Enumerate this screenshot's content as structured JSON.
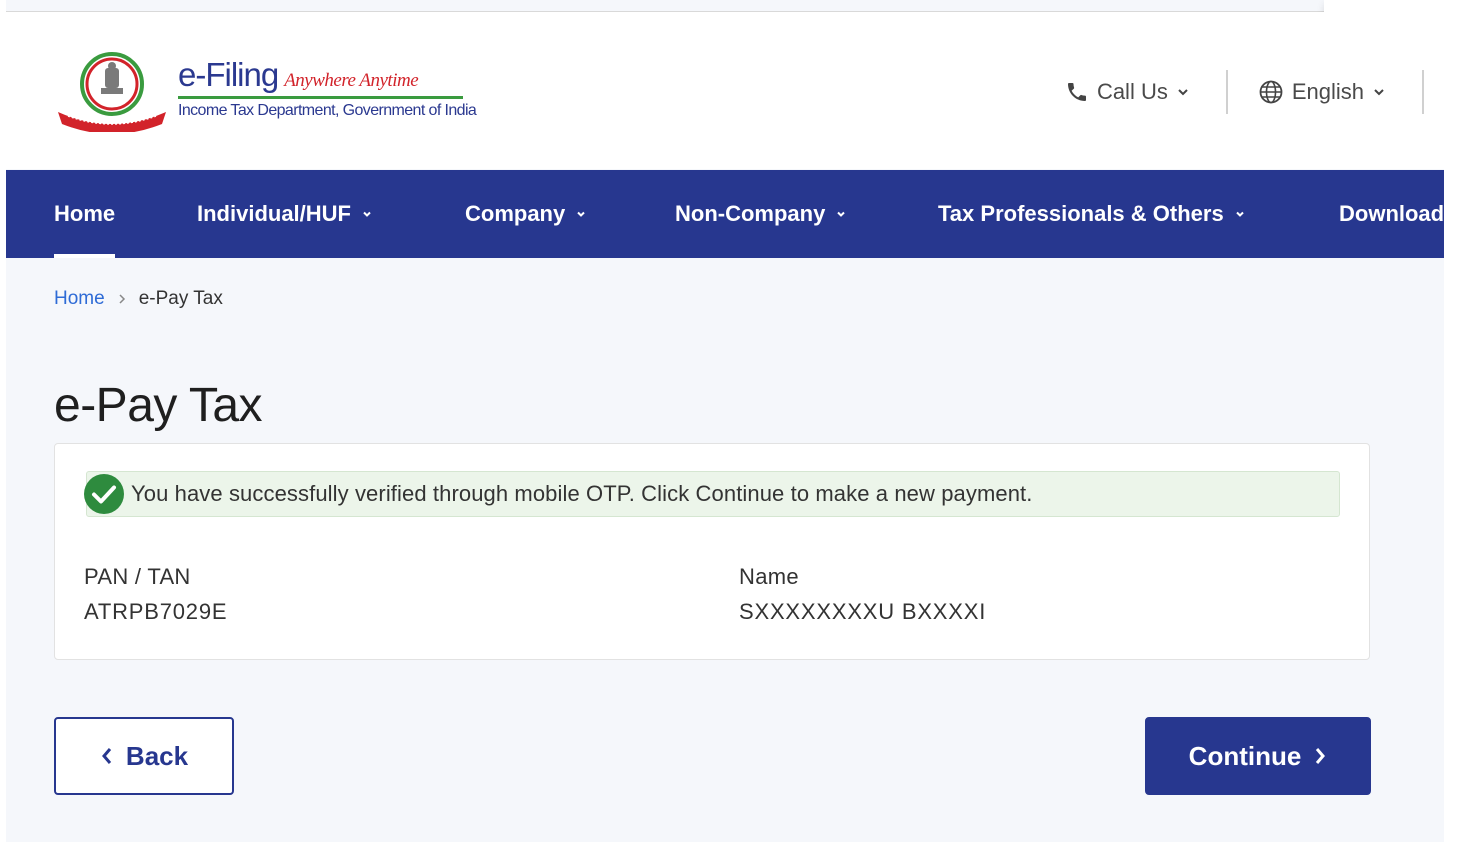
{
  "header": {
    "brand_title": "e-Filing",
    "brand_tagline": "Anywhere Anytime",
    "brand_subtitle": "Income Tax Department, Government of India",
    "call_us_label": "Call Us",
    "language_label": "English"
  },
  "nav": {
    "items": [
      {
        "label": "Home",
        "has_dropdown": false
      },
      {
        "label": "Individual/HUF",
        "has_dropdown": true
      },
      {
        "label": "Company",
        "has_dropdown": true
      },
      {
        "label": "Non-Company",
        "has_dropdown": true
      },
      {
        "label": "Tax Professionals & Others",
        "has_dropdown": true
      },
      {
        "label": "Downloads",
        "has_dropdown": false
      }
    ]
  },
  "breadcrumb": {
    "home": "Home",
    "current": "e-Pay Tax"
  },
  "page": {
    "title": "e-Pay Tax"
  },
  "alert": {
    "message": "You have successfully verified through mobile OTP. Click Continue to make a new payment."
  },
  "details": {
    "pan_label": "PAN / TAN",
    "pan_value": "ATRPB7029E",
    "name_label": "Name",
    "name_value": "SXXXXXXXXU BXXXXI"
  },
  "actions": {
    "back_label": "Back",
    "continue_label": "Continue"
  },
  "colors": {
    "primary": "#27378f",
    "link": "#2e6bd6",
    "success": "#2e8b3e",
    "alert_bg": "#ecf5ea"
  }
}
